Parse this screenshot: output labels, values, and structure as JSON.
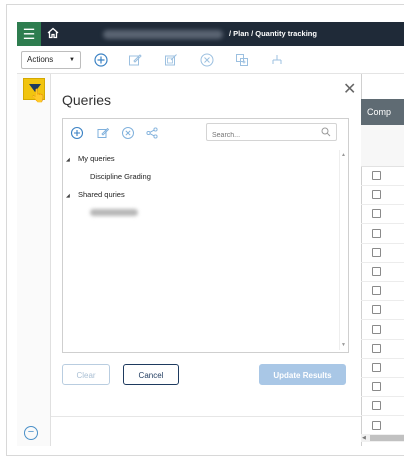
{
  "breadcrumb": {
    "trail": "/ Plan / Quantity tracking"
  },
  "toolbar": {
    "actions_label": "Actions",
    "icons": [
      "add-icon",
      "edit-icon",
      "edit-multi-icon",
      "delete-icon",
      "copy-icon",
      "hierarchy-icon"
    ]
  },
  "panel": {
    "title": "Queries",
    "search_placeholder": "Search...",
    "tree": {
      "my_queries_label": "My queries",
      "my_queries_items": [
        "Discipline Grading"
      ],
      "shared_label": "Shared quries"
    },
    "buttons": {
      "clear": "Clear",
      "cancel": "Cancel",
      "update": "Update Results"
    }
  },
  "grid": {
    "header_label": "Comp",
    "row_count": 14
  },
  "colors": {
    "topbar": "#1f2a38",
    "menu_button": "#2e7d4f",
    "filter_highlight": "#f1c40f",
    "accent_blue": "#4a90c8",
    "primary_disabled": "#a9c7e6",
    "grid_header": "#5f6b73"
  }
}
